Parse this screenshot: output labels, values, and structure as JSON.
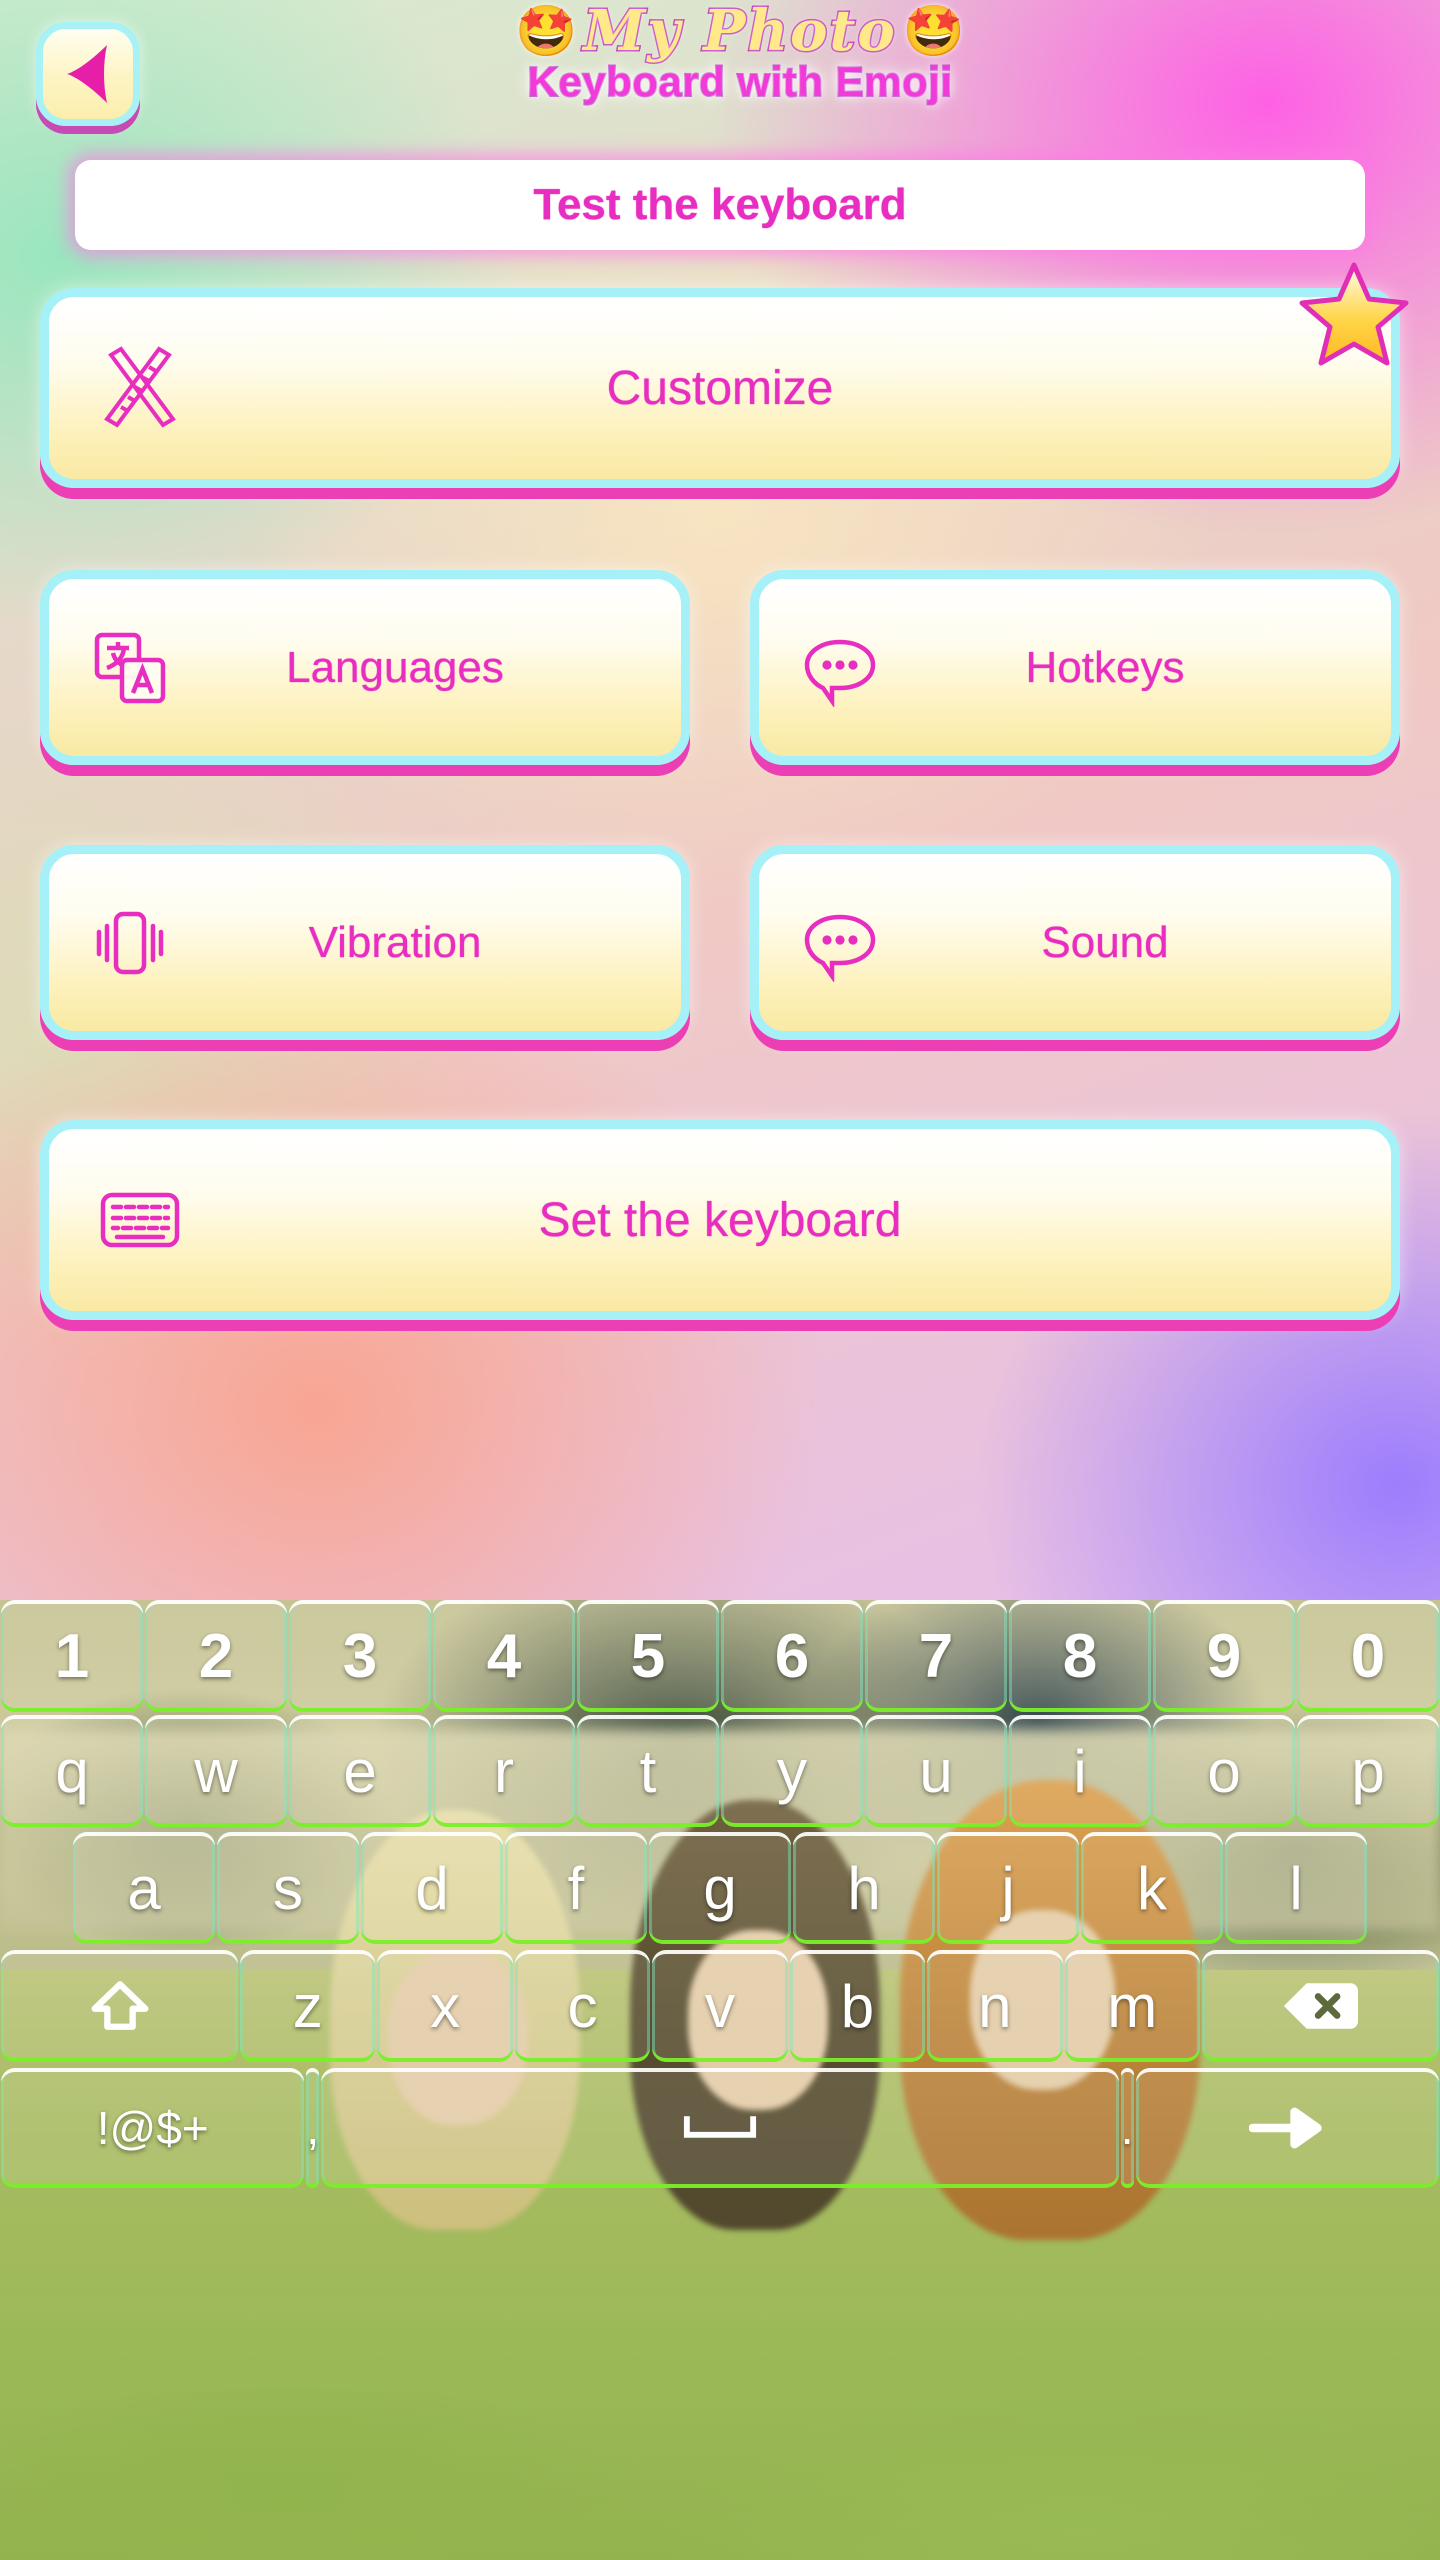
{
  "app": {
    "title_script": "My Photo",
    "title_sub": "Keyboard with Emoji",
    "emoji_left": "🤩",
    "emoji_right": "🤩"
  },
  "colors": {
    "accent_pink": "#e82ec0",
    "border_cyan": "#a6f1f7",
    "shadow_magenta": "#ec3fb6",
    "btn_fill_top": "#ffffff",
    "btn_fill_bottom": "#f9e9a4",
    "star_yellow": "#ffd23a",
    "key_text": "#ffffff"
  },
  "nav": {
    "back_label": "Back",
    "back_icon": "back-triangle-icon"
  },
  "test_field": {
    "value": "Test the keyboard",
    "placeholder": "Test the keyboard"
  },
  "menu": {
    "items": [
      {
        "id": "customize",
        "label": "Customize",
        "icon": "pencil-ruler-icon",
        "badge": "star-badge"
      },
      {
        "id": "languages",
        "label": "Languages",
        "icon": "translate-icon",
        "badge": ""
      },
      {
        "id": "hotkeys",
        "label": "Hotkeys",
        "icon": "speech-bubble-icon",
        "badge": ""
      },
      {
        "id": "vibration",
        "label": "Vibration",
        "icon": "vibrate-phone-icon",
        "badge": ""
      },
      {
        "id": "sound",
        "label": "Sound",
        "icon": "speech-bubble-icon",
        "badge": ""
      },
      {
        "id": "setkb",
        "label": "Set the keyboard",
        "icon": "keyboard-icon",
        "badge": ""
      }
    ]
  },
  "keyboard": {
    "theme": "photo-girls-in-grass",
    "rows": {
      "numbers": [
        "1",
        "2",
        "3",
        "4",
        "5",
        "6",
        "7",
        "8",
        "9",
        "0"
      ],
      "top": [
        "q",
        "w",
        "e",
        "r",
        "t",
        "y",
        "u",
        "i",
        "o",
        "p"
      ],
      "home": [
        "a",
        "s",
        "d",
        "f",
        "g",
        "h",
        "j",
        "k",
        "l"
      ],
      "bottom": [
        "z",
        "x",
        "c",
        "v",
        "b",
        "n",
        "m"
      ]
    },
    "shift_key": {
      "label": "",
      "icon": "shift-arrow-icon"
    },
    "backspace_key": {
      "label": "",
      "icon": "backspace-icon"
    },
    "symbols_key": {
      "label": "!@$+",
      "icon": "symbols-icon"
    },
    "comma_key": {
      "label": ",",
      "icon": "comma-icon"
    },
    "space_key": {
      "label": "",
      "icon": "space-icon"
    },
    "period_key": {
      "label": ".",
      "icon": "period-icon"
    },
    "enter_key": {
      "label": "",
      "icon": "enter-arrow-icon"
    }
  }
}
